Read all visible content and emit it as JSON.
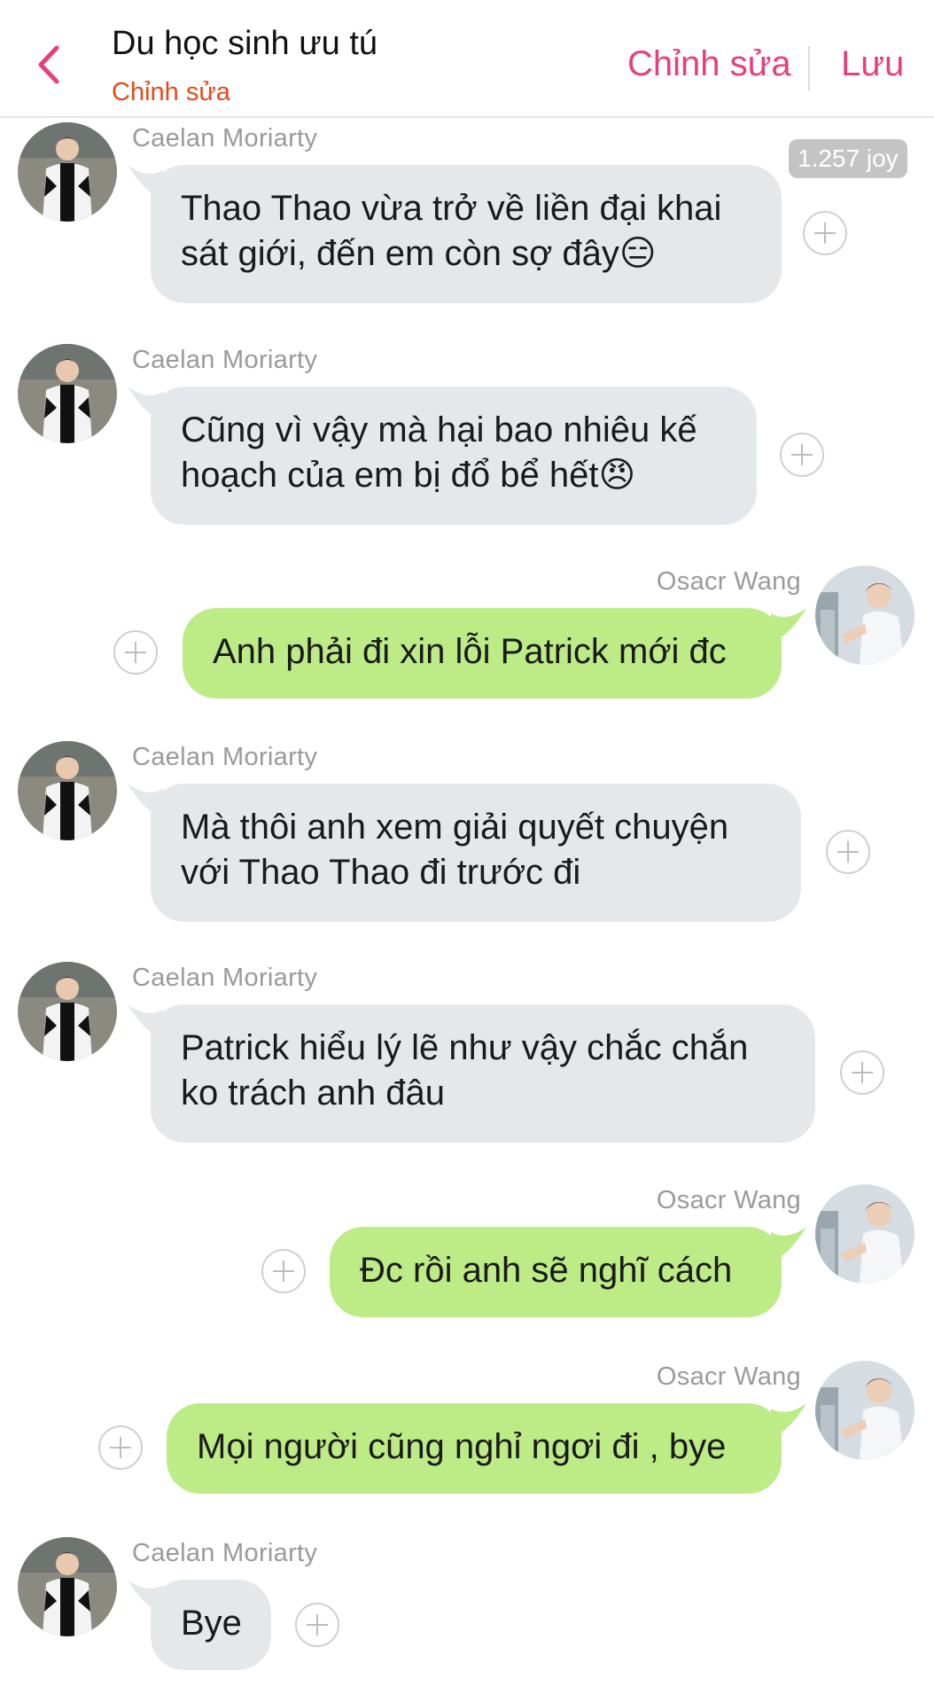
{
  "header": {
    "title": "Du học sinh ưu tú",
    "subtitle": "Chỉnh sửa",
    "edit_label": "Chỉnh sửa",
    "save_label": "Lưu"
  },
  "joy_badge": "1.257 joy",
  "messages": [
    {
      "side": "left",
      "sender": "Caelan Moriarty",
      "lines": [
        "Thao Thao vừa trở về liền đại khai",
        "sát giới, đến em còn sợ đây😑"
      ]
    },
    {
      "side": "left",
      "sender": "Caelan Moriarty",
      "lines": [
        "Cũng vì vậy mà hại bao nhiêu kế",
        "hoạch của em bị đổ bể hết😠"
      ]
    },
    {
      "side": "right",
      "sender": "Osacr Wang",
      "lines": [
        "Anh phải đi xin lỗi Patrick mới đc"
      ]
    },
    {
      "side": "left",
      "sender": "Caelan Moriarty",
      "lines": [
        "Mà thôi anh xem giải quyết chuyện",
        "với Thao Thao đi trước đi"
      ]
    },
    {
      "side": "left",
      "sender": "Caelan Moriarty",
      "lines": [
        "Patrick hiểu lý lẽ như vậy chắc chắn",
        "ko trách anh đâu"
      ]
    },
    {
      "side": "right",
      "sender": "Osacr Wang",
      "lines": [
        "Đc rồi anh sẽ nghĩ cách"
      ]
    },
    {
      "side": "right",
      "sender": "Osacr Wang",
      "lines": [
        "Mọi người cũng nghỉ ngơi đi , bye"
      ]
    },
    {
      "side": "left",
      "sender": "Caelan Moriarty",
      "lines": [
        "Bye"
      ]
    }
  ],
  "colors": {
    "accent": "#e83e7e",
    "subtitle": "#e64a19",
    "left_bubble": "#e5e8ea",
    "right_bubble": "#bdeb85"
  }
}
